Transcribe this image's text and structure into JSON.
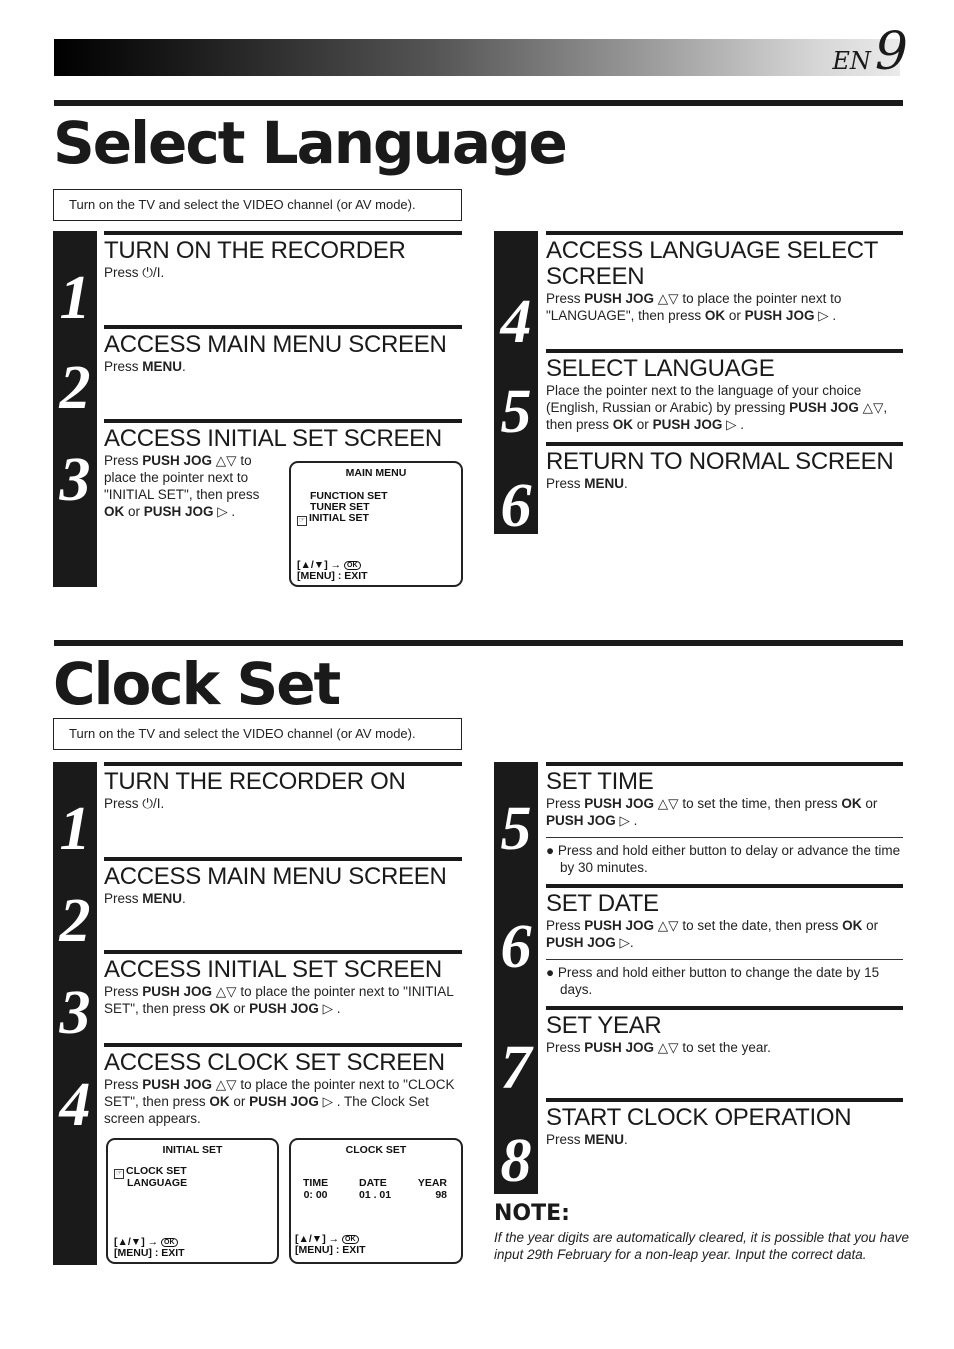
{
  "header": {
    "lang": "EN",
    "page_number": "9"
  },
  "select_language": {
    "title": "Select Language",
    "note": "Turn on the TV and select the VIDEO channel (or AV mode).",
    "steps": [
      {
        "num": "1",
        "title": "TURN ON THE RECORDER",
        "pre": "Press ",
        "icon": "power-standby-icon",
        "icon_glyph": "⏻/I",
        "post": "."
      },
      {
        "num": "2",
        "title": "ACCESS MAIN MENU SCREEN",
        "pre": "Press ",
        "bold": "MENU",
        "post": "."
      },
      {
        "num": "3",
        "title": "ACCESS INITIAL SET SCREEN",
        "text": [
          "Press ",
          "PUSH JOG",
          " △▽ to place the pointer next to \"INITIAL SET\", then press ",
          "OK",
          " or ",
          "PUSH JOG",
          " ▷ ."
        ]
      },
      {
        "num": "4",
        "title": "ACCESS LANGUAGE SELECT SCREEN",
        "text": [
          "Press ",
          "PUSH JOG",
          " △▽ to place the pointer next to \"LANGUAGE\", then press ",
          "OK",
          " or ",
          "PUSH JOG",
          " ▷ ."
        ]
      },
      {
        "num": "5",
        "title": "SELECT LANGUAGE",
        "text": [
          "Place the pointer next to the language of your choice (English, Russian or Arabic) by pressing ",
          "PUSH JOG",
          " △▽, then press ",
          "OK",
          " or ",
          "PUSH JOG",
          " ▷ ."
        ]
      },
      {
        "num": "6",
        "title": "RETURN TO NORMAL SCREEN",
        "pre": "Press ",
        "bold": "MENU",
        "post": "."
      }
    ],
    "main_menu_screen": {
      "title": "MAIN MENU",
      "items": [
        "FUNCTION SET",
        "TUNER SET",
        "INITIAL SET"
      ],
      "selected": "INITIAL SET",
      "nav_hint": "[▲/▼] →",
      "ok_label": "OK",
      "exit_hint": "[MENU] : EXIT"
    }
  },
  "clock_set": {
    "title": "Clock Set",
    "note": "Turn on the TV and select the VIDEO channel (or AV mode).",
    "steps": [
      {
        "num": "1",
        "title": "TURN THE RECORDER ON",
        "pre": "Press ",
        "icon_glyph": "⏻/I",
        "post": "."
      },
      {
        "num": "2",
        "title": "ACCESS MAIN MENU SCREEN",
        "pre": "Press ",
        "bold": "MENU",
        "post": "."
      },
      {
        "num": "3",
        "title": "ACCESS INITIAL SET SCREEN",
        "text": [
          "Press ",
          "PUSH JOG",
          " △▽ to place the pointer next to \"INITIAL SET\", then press ",
          "OK",
          " or ",
          "PUSH JOG",
          " ▷ ."
        ]
      },
      {
        "num": "4",
        "title": "ACCESS CLOCK SET SCREEN",
        "text": [
          "Press ",
          "PUSH JOG",
          " △▽ to place the pointer next  to \"CLOCK SET\", then press ",
          "OK",
          " or ",
          "PUSH JOG",
          " ▷ . The Clock Set screen appears."
        ]
      },
      {
        "num": "5",
        "title": "SET TIME",
        "text": [
          "Press ",
          "PUSH JOG",
          " △▽ to set the time, then press ",
          "OK",
          " or ",
          "PUSH JOG",
          " ▷ ."
        ],
        "bullet": "Press and hold either button to delay or advance the time by 30 minutes."
      },
      {
        "num": "6",
        "title": "SET DATE",
        "text": [
          "Press ",
          "PUSH JOG",
          " △▽ to set the date, then press ",
          "OK",
          " or ",
          "PUSH JOG",
          " ▷."
        ],
        "bullet": "Press and hold either button to change the date by 15 days."
      },
      {
        "num": "7",
        "title": "SET YEAR",
        "text": [
          "Press ",
          "PUSH JOG",
          " △▽ to set the year."
        ]
      },
      {
        "num": "8",
        "title": "START CLOCK OPERATION",
        "pre": "Press ",
        "bold": "MENU",
        "post": "."
      }
    ],
    "initial_set_screen": {
      "title": "INITIAL SET",
      "items": [
        "CLOCK SET",
        "LANGUAGE"
      ],
      "selected": "CLOCK SET",
      "nav_hint": "[▲/▼] →",
      "ok_label": "OK",
      "exit_hint": "[MENU] : EXIT"
    },
    "clock_set_screen": {
      "title": "CLOCK SET",
      "fields": [
        {
          "label": "TIME",
          "value": "0: 00"
        },
        {
          "label": "DATE",
          "value": "01 . 01"
        },
        {
          "label": "YEAR",
          "value": "98"
        }
      ],
      "nav_hint": "[▲/▼] →",
      "ok_label": "OK",
      "exit_hint": "[MENU] : EXIT"
    },
    "note_title": "NOTE:",
    "note_text": "If the year digits are automatically cleared, it is possible that you have input 29th February for a non-leap year. Input the correct data."
  }
}
